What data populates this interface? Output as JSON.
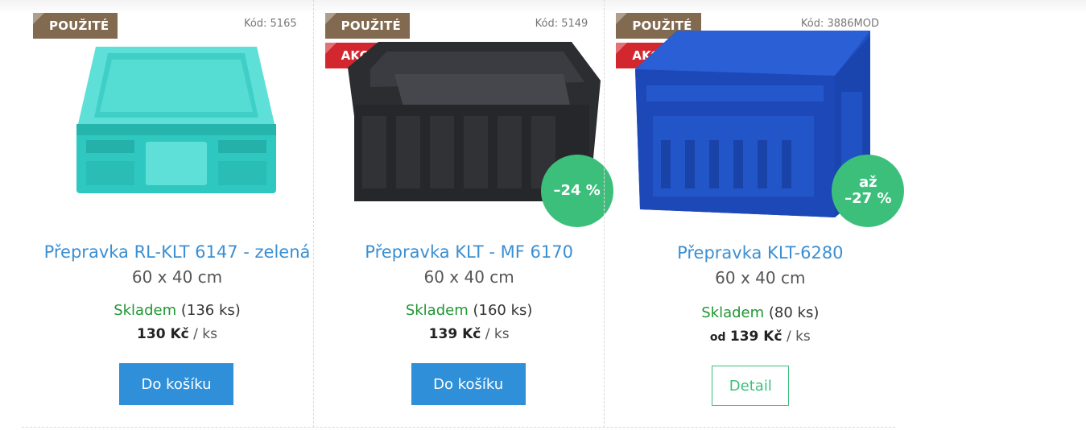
{
  "products": [
    {
      "flags": [
        "POUŽITÉ"
      ],
      "code": "Kód: 5165",
      "image_icon": "teal-crate-image",
      "name": "Přepravka RL-KLT 6147 - zelená",
      "dimensions": "60 x 40 cm",
      "stock_label": "Skladem",
      "stock_count": "(136 ks)",
      "price_prefix": "",
      "price": "130 Kč",
      "unit": "/ ks",
      "button": "Do košíku",
      "color": "#2ec8c0"
    },
    {
      "flags": [
        "POUŽITÉ",
        "AKCE"
      ],
      "code": "Kód: 5149",
      "image_icon": "black-crate-image",
      "discount": "–24 %",
      "name": "Přepravka KLT - MF 6170",
      "dimensions": "60 x 40 cm",
      "stock_label": "Skladem",
      "stock_count": "(160 ks)",
      "price_prefix": "",
      "price": "139 Kč",
      "unit": "/ ks",
      "button": "Do košíku",
      "color": "#2b2d31"
    },
    {
      "flags": [
        "POUŽITÉ",
        "AKCE"
      ],
      "code": "Kód: 3886MOD",
      "image_icon": "blue-crate-image",
      "discount_prefix": "až",
      "discount": "–27 %",
      "name": "Přepravka KLT-6280",
      "dimensions": "60 x 40 cm",
      "stock_label": "Skladem",
      "stock_count": "(80 ks)",
      "price_prefix": "od",
      "price": "139 Kč",
      "unit": "/ ks",
      "button": "Detail",
      "color": "#1f4fc4"
    }
  ],
  "colors": {
    "used_flag": "#826a50",
    "sale_flag": "#d2272f",
    "discount": "#3dbf7c",
    "link": "#3b8fd2",
    "in_stock": "#219633",
    "button": "#2f8fd8"
  }
}
